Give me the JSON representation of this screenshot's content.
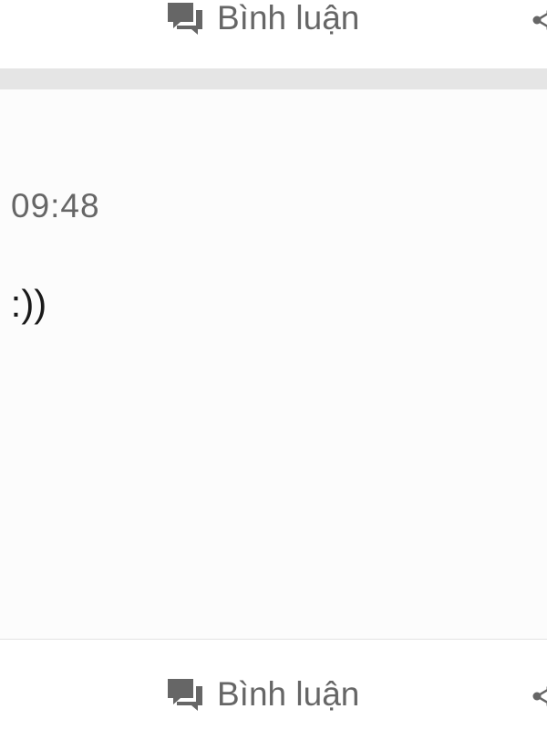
{
  "actions": {
    "comment_label": "Bình luận",
    "comment_icon": "comment-icon",
    "share_icon": "share-icon"
  },
  "post": {
    "time": "09:48",
    "body": ") :))"
  },
  "colors": {
    "text_muted": "#666666",
    "text_main": "#1a1a1a",
    "separator": "#e5e5e5"
  }
}
